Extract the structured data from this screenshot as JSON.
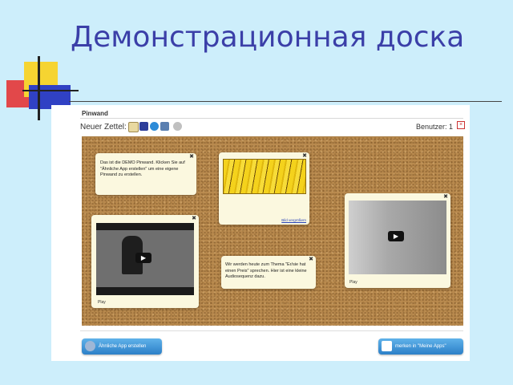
{
  "slide": {
    "title": "Демонстрационная доска"
  },
  "app": {
    "title": "Pinwand",
    "toolbar": {
      "label": "Neuer Zettel:",
      "icons": [
        "note-icon",
        "image-icon",
        "link-icon",
        "video-icon",
        "settings-icon"
      ],
      "users_label": "Benutzer:",
      "users_count": "1"
    },
    "notes": [
      {
        "text": "Das ist die DEMO Pinwand. Klicken Sie auf \"Ähnliche App erstellen\" um eine eigene Pinwand zu erstellen."
      },
      {
        "link": "Bild vergrößern"
      },
      {
        "caption": "Play"
      },
      {
        "text": "Wir werden heute zum Thema \"Er/sie hat einen Preis\" sprechen. Hier ist eine kleine Audiosequenz dazu."
      },
      {
        "caption": "Play"
      }
    ],
    "buttons": {
      "similar_app": "Ähnliche App erstellen",
      "my_apps": "merken in \"Meine Apps\""
    }
  },
  "colors": {
    "title": "#3b3fa8",
    "background": "#cdeefb",
    "cork": "#b98a4e",
    "note": "#fbf8df",
    "button": "#2c7fc7"
  }
}
